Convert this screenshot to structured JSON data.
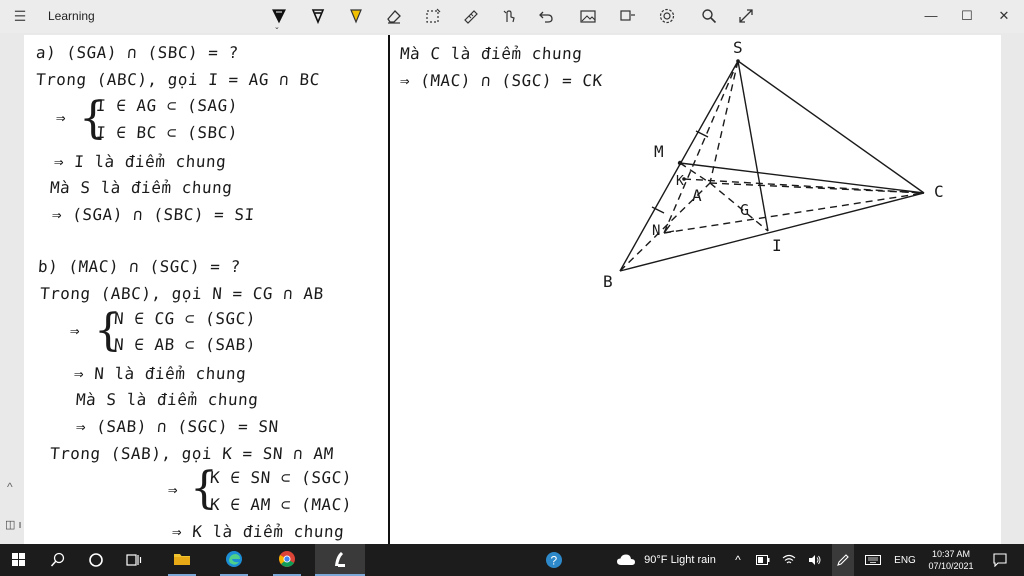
{
  "app": {
    "title": "Learning",
    "menu_icon": "hamburger-icon"
  },
  "toolbar": {
    "tools": [
      "ballpoint-pen-icon",
      "pencil-icon",
      "highlighter-icon",
      "eraser-icon",
      "lasso-select-icon",
      "ruler-icon",
      "touch-writing-icon",
      "undo-icon",
      "add-image-icon",
      "shapes-icon",
      "settings-icon",
      "zoom-icon",
      "expand-icon"
    ],
    "colors": {
      "pen_black": "#111111",
      "highlighter": "#f2c200"
    }
  },
  "window": {
    "minimize": "—",
    "maximize": "☐",
    "close": "✕"
  },
  "note_left": {
    "a_title": "a) (SGA) ∩ (SBC) = ?",
    "a_line1": "Trong (ABC), gọi I = AG ∩ BC",
    "a_arrow": "⇒",
    "a_case1": "I ∈ AG ⊂ (SAG)",
    "a_case2": "I ∈ BC ⊂ (SBC)",
    "a_line2": "⇒ I là điểm chung",
    "a_line3": "Mà S là điểm chung",
    "a_line4": "⇒ (SGA) ∩ (SBC) = SI",
    "b_title": "b) (MAC) ∩ (SGC) = ?",
    "b_line1": "Trong (ABC), gọi N = CG ∩ AB",
    "b_arrow": "⇒",
    "b_case1": "N ∈ CG ⊂ (SGC)",
    "b_case2": "N ∈ AB ⊂ (SAB)",
    "b_line2": "⇒ N là điểm chung",
    "b_line3": "Mà S là điểm chung",
    "b_line4": "⇒ (SAB) ∩ (SGC) = SN",
    "b_line5": "Trong (SAB), gọi K = SN ∩ AM",
    "b_arrow2": "⇒",
    "b_case3": "K ∈ SN ⊂ (SGC)",
    "b_case4": "K ∈ AM ⊂ (MAC)",
    "b_line6": "⇒ K là điểm chung"
  },
  "note_right": {
    "line1": "Mà C là điểm chung",
    "line2": "⇒ (MAC) ∩ (SGC) = CK"
  },
  "figure": {
    "labels": {
      "S": "S",
      "M": "M",
      "K": "K",
      "A": "A",
      "G": "G",
      "C": "C",
      "N": "N",
      "I": "I",
      "B": "B"
    }
  },
  "sidebar": {
    "scroll_up": "^",
    "panel_icon": "panel-toggle-icon"
  },
  "taskbar": {
    "start_icon": "windows-start-icon",
    "search_icon": "search-icon",
    "cortana_icon": "cortana-icon",
    "taskview_icon": "task-view-icon",
    "apps": [
      "file-explorer-icon",
      "edge-icon",
      "chrome-icon",
      "whiteboard-app-icon"
    ],
    "help_icon": "help-icon",
    "weather_icon": "cloud-icon",
    "weather": "90°F  Light rain",
    "tray_chevron": "^",
    "language": "ENG",
    "time": "10:37 AM",
    "date": "07/10/2021",
    "notification_icon": "notification-icon"
  }
}
